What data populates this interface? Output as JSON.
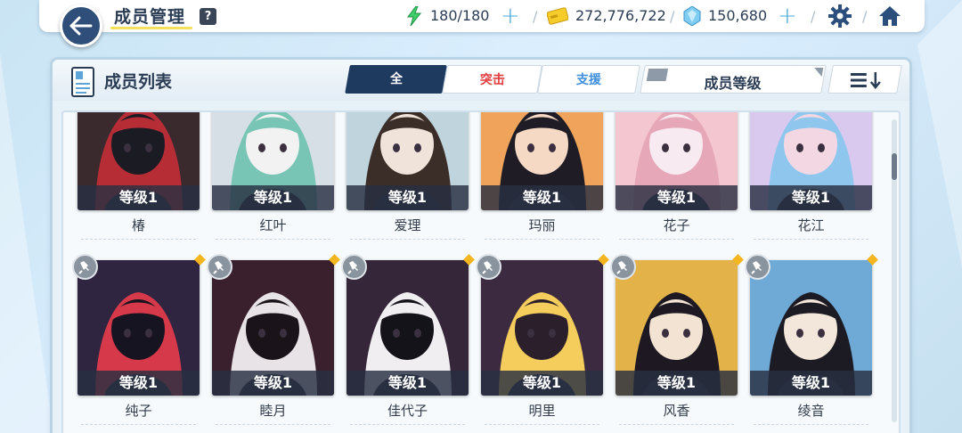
{
  "header": {
    "title": "成员管理",
    "help_icon": "?",
    "ap": "180/180",
    "credits": "272,776,722",
    "pyroxene": "150,680"
  },
  "panel": {
    "title": "成员列表",
    "tabs": [
      {
        "label": "全",
        "active": true
      },
      {
        "label": "突击",
        "color": "#e23c3c"
      },
      {
        "label": "支援",
        "color": "#3f8fdc"
      }
    ],
    "sort_label": "成员等级"
  },
  "row1": [
    {
      "name": "椿",
      "level": "等级1",
      "colors": [
        "#3a2a2e",
        "#b72d36",
        "#1b1b24"
      ]
    },
    {
      "name": "红叶",
      "level": "等级1",
      "colors": [
        "#d7dfe6",
        "#79c5b5",
        "#f2f2f2"
      ]
    },
    {
      "name": "爱理",
      "level": "等级1",
      "colors": [
        "#bfd4dc",
        "#3b2d28",
        "#f0e3da"
      ]
    },
    {
      "name": "玛丽",
      "level": "等级1",
      "colors": [
        "#f0a35a",
        "#1f1c25",
        "#f5d9c4"
      ]
    },
    {
      "name": "花子",
      "level": "等级1",
      "colors": [
        "#f4c6d0",
        "#e6a8b8",
        "#f7eaf0"
      ]
    },
    {
      "name": "花江",
      "level": "等级1",
      "colors": [
        "#d9c9ef",
        "#8fc6ee",
        "#f3d8e4"
      ]
    }
  ],
  "row2": [
    {
      "name": "纯子",
      "level": "等级1",
      "colors": [
        "#2f2540",
        "#d63a4a",
        "#161420"
      ]
    },
    {
      "name": "睦月",
      "level": "等级1",
      "colors": [
        "#3a1f2c",
        "#e8e3e6",
        "#1a141a"
      ]
    },
    {
      "name": "佳代子",
      "level": "等级1",
      "colors": [
        "#35263a",
        "#f0eef0",
        "#15131a"
      ]
    },
    {
      "name": "明里",
      "level": "等级1",
      "colors": [
        "#3c2a40",
        "#f4cd5c",
        "#2a1f2a"
      ]
    },
    {
      "name": "风香",
      "level": "等级1",
      "colors": [
        "#e3b34a",
        "#1d1822",
        "#f2e3d3"
      ]
    },
    {
      "name": "绫音",
      "level": "等级1",
      "colors": [
        "#6fa9d6",
        "#1c1a22",
        "#f3e6da"
      ]
    }
  ],
  "icons": {
    "back": "back-arrow-icon",
    "ap": "lightning-icon",
    "credits": "credit-card-icon",
    "pyroxene": "pyroxene-gem-icon",
    "settings": "gear-icon",
    "home": "home-icon",
    "list": "student-card-icon",
    "order": "sort-order-icon",
    "pin": "pin-icon"
  }
}
